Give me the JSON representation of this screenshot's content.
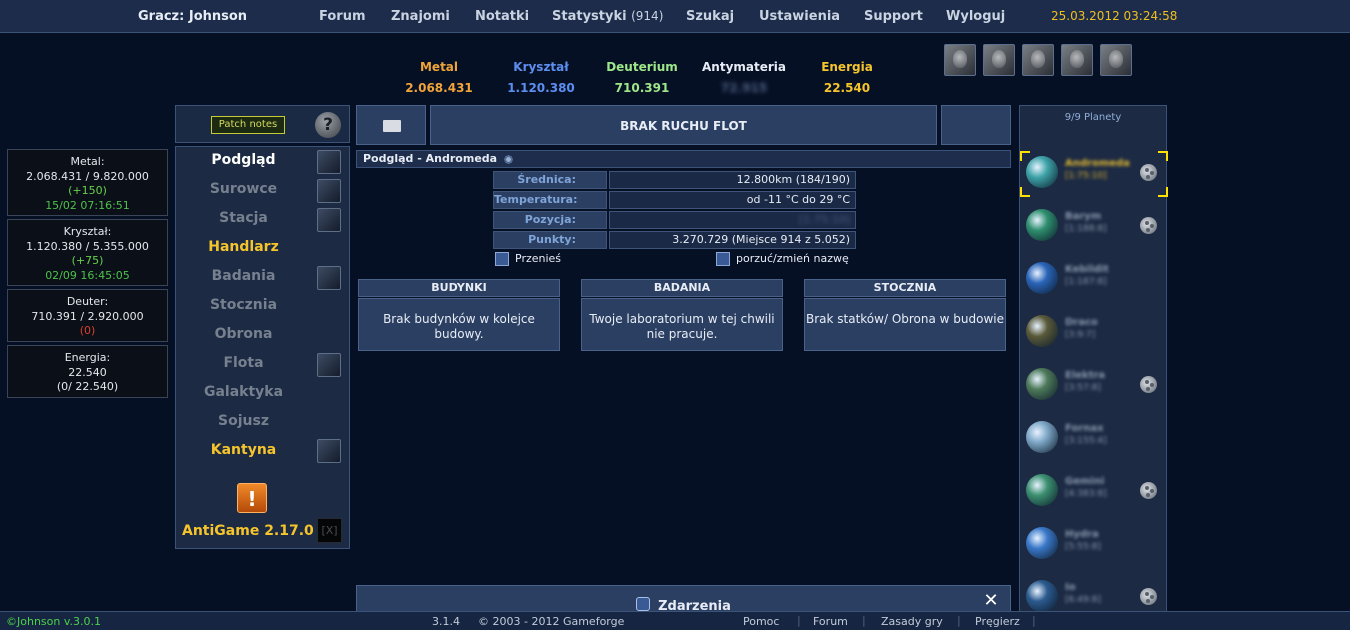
{
  "topbar": {
    "player": "Gracz: Johnson",
    "nav": [
      {
        "label": "Forum"
      },
      {
        "label": "Znajomi"
      },
      {
        "label": "Notatki"
      },
      {
        "label": "Statystyki",
        "extra": "(914)"
      },
      {
        "label": "Szukaj"
      },
      {
        "label": "Ustawienia"
      },
      {
        "label": "Support"
      },
      {
        "label": "Wyloguj"
      }
    ],
    "datetime": "25.03.2012 03:24:58"
  },
  "resources": [
    {
      "name": "Metal",
      "value": "2.068.431",
      "color": "#f1a43a"
    },
    {
      "name": "Kryształ",
      "value": "1.120.380",
      "color": "#5c8ef0"
    },
    {
      "name": "Deuterium",
      "value": "710.391",
      "color": "#9ee88a"
    },
    {
      "name": "Antymateria",
      "value": "72.915",
      "color": "#e8edf5"
    },
    {
      "name": "Energia",
      "value": "22.540",
      "color": "#f5c52b"
    }
  ],
  "officers": [
    "officer-commander-icon",
    "officer-admiral-icon",
    "officer-engineer-icon",
    "officer-geologist-icon",
    "officer-technocrat-icon"
  ],
  "resource_boxes": [
    {
      "label": "Metal:",
      "amount": "2.068.431 / 9.820.000",
      "prod": "(+150)",
      "time": "15/02 07:16:51"
    },
    {
      "label": "Kryształ:",
      "amount": "1.120.380 / 5.355.000",
      "prod": "(+75)",
      "time": "02/09 16:45:05"
    },
    {
      "label": "Deuter:",
      "amount": "710.391 / 2.920.000",
      "prod": "(0)"
    },
    {
      "label": "Energia:",
      "amount": "22.540",
      "prod": "(0/ 22.540)"
    }
  ],
  "menu": {
    "patch_notes": "Patch notes",
    "help": "?",
    "items": [
      {
        "label": "Podgląd"
      },
      {
        "label": "Surowce"
      },
      {
        "label": "Stacja"
      },
      {
        "label": "Handlarz"
      },
      {
        "label": "Badania"
      },
      {
        "label": "Stocznia"
      },
      {
        "label": "Obrona"
      },
      {
        "label": "Flota"
      },
      {
        "label": "Galaktyka"
      },
      {
        "label": "Sojusz"
      },
      {
        "label": "Kantyna"
      }
    ],
    "alert": "!",
    "antigame": "AntiGame 2.17.0",
    "antigame_close": "[X]"
  },
  "fleet": {
    "status": "BRAK RUCHU FLOT"
  },
  "overview": {
    "header": "Podgląd - Andromeda",
    "rows": [
      {
        "label": "Średnica:",
        "value": "12.800km (184/190)"
      },
      {
        "label": "Temperatura:",
        "value": "od -11 °C do 29 °C"
      },
      {
        "label": "Pozycja:",
        "value": "[1:75:10]"
      },
      {
        "label": "Punkty:",
        "value": "3.270.729 (Miejsce 914 z 5.052)"
      }
    ],
    "relocate": "Przenieś",
    "rename": "porzuć/zmień nazwę"
  },
  "queues": [
    {
      "title": "BUDYNKI",
      "text": "Brak budynków w kolejce budowy."
    },
    {
      "title": "BADANIA",
      "text": "Twoje laboratorium w tej chwili nie pracuje."
    },
    {
      "title": "STOCZNIA",
      "text": "Brak statków/ Obrona w budowie"
    }
  ],
  "events": {
    "label": "Zdarzenia"
  },
  "planets": {
    "count": "9/9 Planety",
    "list": [
      {
        "name": "Andromeda",
        "coords": "[1:75:10]",
        "moon": true,
        "selected": true,
        "color": "#3ea3a8"
      },
      {
        "name": "Barym",
        "coords": "[1:188:8]",
        "moon": true,
        "color": "#2f8f6e"
      },
      {
        "name": "Kebildit",
        "coords": "[1:187:8]",
        "moon": false,
        "color": "#2a64b8"
      },
      {
        "name": "Draco",
        "coords": "[3:9:7]",
        "moon": false,
        "color": "#5a5a3a"
      },
      {
        "name": "Elektra",
        "coords": "[3:57:8]",
        "moon": true,
        "color": "#4e7a5a"
      },
      {
        "name": "Fornax",
        "coords": "[3:155:4]",
        "moon": false,
        "color": "#7fa8c8"
      },
      {
        "name": "Gemini",
        "coords": "[4:383:8]",
        "moon": true,
        "color": "#3c9070"
      },
      {
        "name": "Hydra",
        "coords": "[5:55:8]",
        "moon": false,
        "color": "#3a78c9"
      },
      {
        "name": "Io",
        "coords": "[6:49:8]",
        "moon": true,
        "color": "#2b5a8e"
      }
    ]
  },
  "footer": {
    "version": "©Johnson v.3.0.1",
    "game_version": "3.1.4",
    "copyright": "© 2003 - 2012 Gameforge",
    "links": [
      "Pomoc",
      "Forum",
      "Zasady gry",
      "Pręgierz"
    ]
  }
}
